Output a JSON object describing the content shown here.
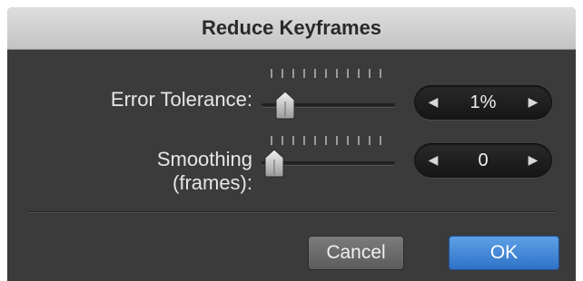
{
  "dialog": {
    "title": "Reduce Keyframes"
  },
  "error_tolerance": {
    "label": "Error Tolerance:",
    "value": "1%",
    "decrement_glyph": "◀",
    "increment_glyph": "▶",
    "slider_level": 0.05
  },
  "smoothing": {
    "label_line1": "Smoothing",
    "label_line2": "(frames):",
    "value": "0",
    "decrement_glyph": "◀",
    "increment_glyph": "▶",
    "slider_level": 0.0
  },
  "buttons": {
    "cancel_label": "Cancel",
    "ok_label": "OK"
  },
  "colors": {
    "panel_bg": "#3b3b3b",
    "title_bar": "#d2d2d2",
    "accent_blue": "#3a80d2"
  }
}
